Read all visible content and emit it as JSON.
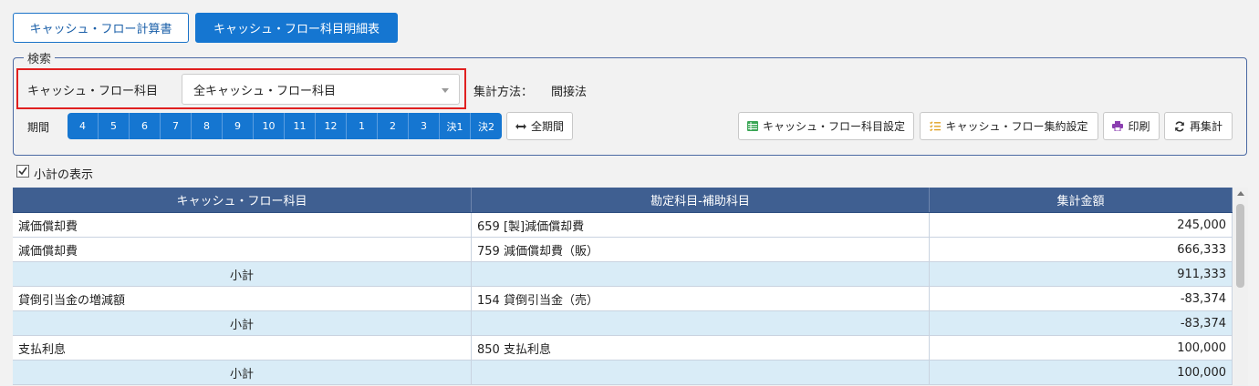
{
  "tabs": [
    {
      "label": "キャッシュ・フロー計算書",
      "active": false
    },
    {
      "label": "キャッシュ・フロー科目明細表",
      "active": true
    }
  ],
  "search": {
    "legend": "検索",
    "cf_item_label": "キャッシュ・フロー科目",
    "cf_item_selected": "全キャッシュ・フロー科目",
    "method_label": "集計方法：",
    "method_value": "間接法",
    "period_label": "期間",
    "periods": [
      "4",
      "5",
      "6",
      "7",
      "8",
      "9",
      "10",
      "11",
      "12",
      "1",
      "2",
      "3",
      "決1",
      "決2"
    ],
    "all_period_label": "全期間"
  },
  "toolbar": {
    "cf_settings_label": "キャッシュ・フロー科目設定",
    "cf_aggregate_label": "キャッシュ・フロー集約設定",
    "print_label": "印刷",
    "recalc_label": "再集計"
  },
  "colors": {
    "accent": "#1576d1",
    "header": "#3f5f91",
    "subtotal_row": "#d9ecf7",
    "highlight": "#e02020"
  },
  "subtotal_toggle": {
    "label": "小計の表示",
    "checked": true
  },
  "table": {
    "columns": [
      "キャッシュ・フロー科目",
      "勘定科目-補助科目",
      "集計金額"
    ],
    "rows": [
      {
        "type": "data",
        "cf": "減価償却費",
        "account": "659 [製]減価償却費",
        "amount": "245,000"
      },
      {
        "type": "data",
        "cf": "減価償却費",
        "account": "759 減価償却費（販）",
        "amount": "666,333"
      },
      {
        "type": "subtotal",
        "cf": "小計",
        "account": "",
        "amount": "911,333"
      },
      {
        "type": "data",
        "cf": "貸倒引当金の増減額",
        "account": "154 貸倒引当金（売）",
        "amount": "-83,374"
      },
      {
        "type": "subtotal",
        "cf": "小計",
        "account": "",
        "amount": "-83,374"
      },
      {
        "type": "data",
        "cf": "支払利息",
        "account": "850 支払利息",
        "amount": "100,000"
      },
      {
        "type": "subtotal",
        "cf": "小計",
        "account": "",
        "amount": "100,000"
      }
    ]
  }
}
